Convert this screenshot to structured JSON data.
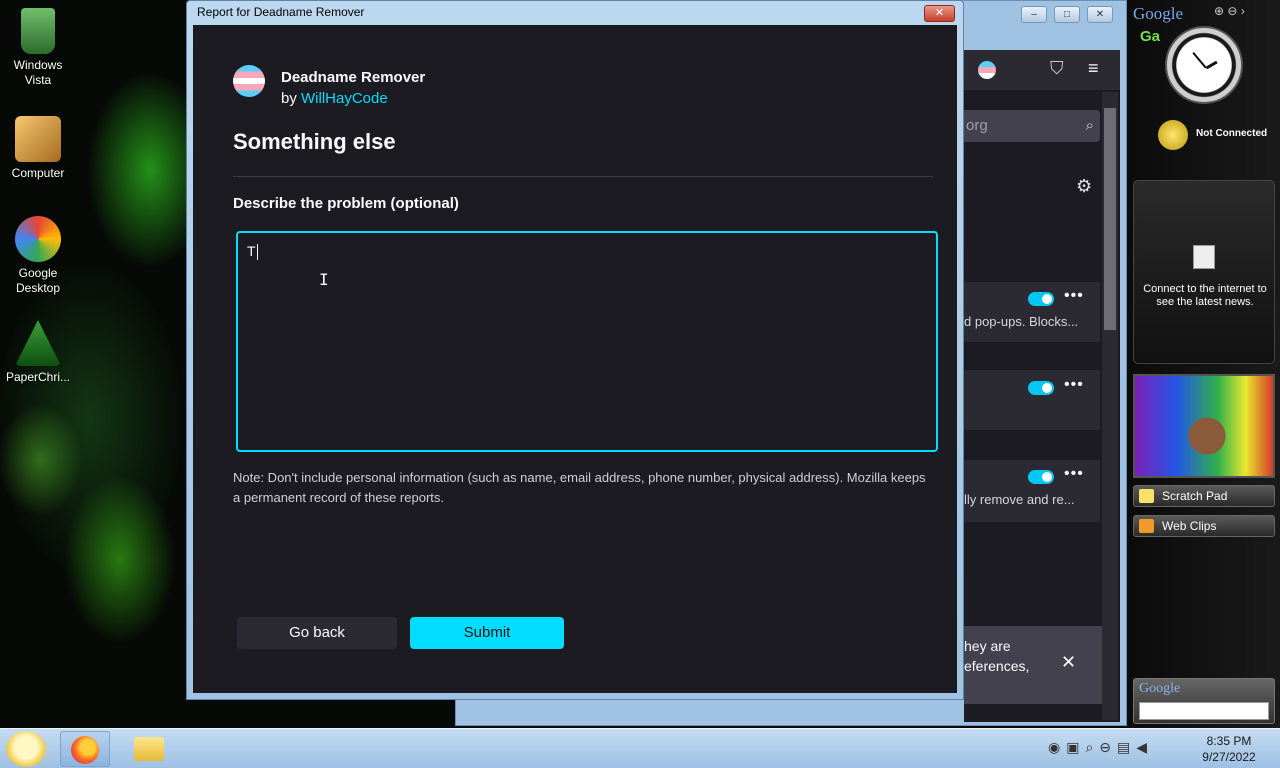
{
  "desktop": {
    "icons": [
      {
        "label": "Windows Vista",
        "icon": "recycle-bin-icon"
      },
      {
        "label": "Computer",
        "icon": "computer-icon"
      },
      {
        "label": "Google Desktop",
        "icon": "google-desktop-icon"
      },
      {
        "label": "PaperChri...",
        "icon": "christmas-tree-icon"
      }
    ]
  },
  "background_window": {
    "search_placeholder": "org",
    "cards": [
      {
        "text": "d pop-ups. Blocks..."
      },
      {
        "text": ""
      },
      {
        "text": "lly remove and re..."
      }
    ],
    "notice_line1": "hey are",
    "notice_line2": "eferences,"
  },
  "dialog": {
    "window_title": "Report for Deadname Remover",
    "extension_name": "Deadname Remover",
    "by_prefix": "by",
    "author": "WillHayCode",
    "heading": "Something else",
    "field_label": "Describe the problem (optional)",
    "field_value": "T",
    "note": "Note: Don't include personal information (such as name, email address, phone number, physical address). Mozilla keeps a permanent record of these reports.",
    "back_label": "Go back",
    "submit_label": "Submit",
    "accent_color": "#00ddff"
  },
  "sidebar": {
    "google_label": "Google",
    "gaming_label": "Ga",
    "connection_status": "Not Connected",
    "news_text": "Connect to the internet to see the latest news.",
    "scratch_pad_label": "Scratch Pad",
    "web_clips_label": "Web Clips",
    "google_search_label": "Google"
  },
  "taskbar": {
    "time": "8:35 PM",
    "date": "9/27/2022"
  }
}
